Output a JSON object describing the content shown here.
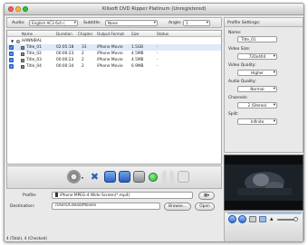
{
  "window": {
    "title": "Xilisoft DVD Ripper Platinum (Unregistered)"
  },
  "toolbar": {
    "audio_label": "Audio:",
    "audio_value": "English AC3 6ch (",
    "subtitle_label": "Subtitle:",
    "subtitle_value": "None",
    "angle_label": "Angle:",
    "angle_value": "1"
  },
  "list": {
    "headers": [
      "Name",
      "Duration",
      "Chapter",
      "Output Format",
      "Size",
      "Status"
    ],
    "group": "HANNIBAL",
    "rows": [
      {
        "name": "Title_01",
        "duration": "02:05:18",
        "chapter": "33",
        "format": "iPhone Movie",
        "size": "1.5GB",
        "status": "-"
      },
      {
        "name": "Title_02",
        "duration": "00:00:23",
        "chapter": "2",
        "format": "iPhone Movie",
        "size": "4.5MB",
        "status": "-"
      },
      {
        "name": "Title_03",
        "duration": "00:00:23",
        "chapter": "2",
        "format": "iPhone Movie",
        "size": "4.5MB",
        "status": "-"
      },
      {
        "name": "Title_04",
        "duration": "00:00:34",
        "chapter": "2",
        "format": "iPhone Movie",
        "size": "6.9MB",
        "status": "-"
      }
    ]
  },
  "bottom": {
    "profile_label": "Profile:",
    "profile_value": "iPhone MPEG-4 Wide Screen(*.mp4)",
    "destination_label": "Destination:",
    "destination_value": "/Users/Cdead/Movies",
    "browse_label": "Browse...",
    "open_label": "Open",
    "status_text": "4 (Total), 4 (Checked)"
  },
  "settings": {
    "header": "Profile Settings:",
    "name_label": "Name:",
    "name_value": "Title_01",
    "video_size_label": "Video Size:",
    "video_size_value": "720x404",
    "video_quality_label": "Video Quality:",
    "video_quality_value": "Higher",
    "audio_quality_label": "Audio Quality:",
    "audio_quality_value": "Normal",
    "channels_label": "Channels:",
    "channels_value": "2 (Stereo)",
    "split_label": "Split:",
    "split_value": "Infinite"
  },
  "colors": {
    "accent": "#3a7be0",
    "selection": "#3a7be0",
    "button_green": "#2fae3a"
  }
}
